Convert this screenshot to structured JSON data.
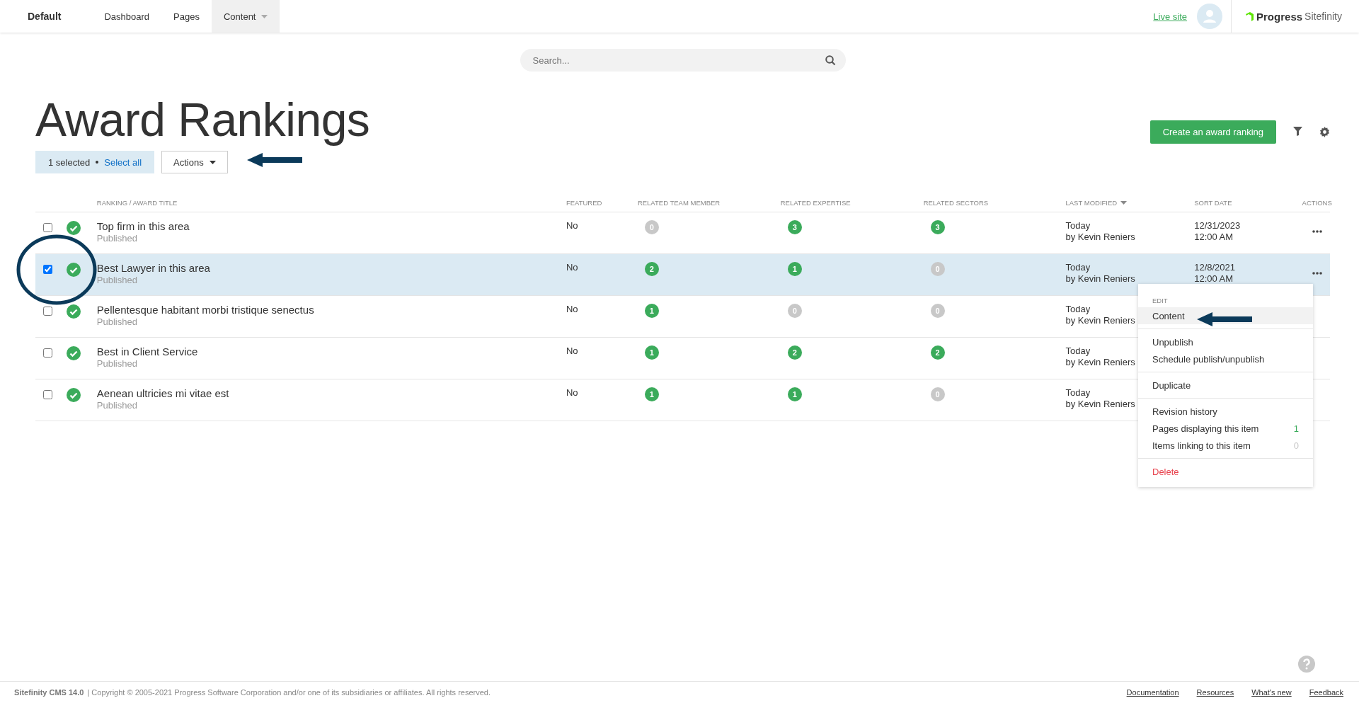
{
  "topbar": {
    "site": "Default",
    "nav": [
      {
        "label": "Dashboard",
        "selected": false,
        "dropdown": false
      },
      {
        "label": "Pages",
        "selected": false,
        "dropdown": false
      },
      {
        "label": "Content",
        "selected": true,
        "dropdown": true
      }
    ],
    "live_site": "Live site",
    "brand": "Progress",
    "brand_product": "Sitefinity"
  },
  "search": {
    "placeholder": "Search..."
  },
  "title": "Award Rankings",
  "selection": {
    "count": "1 selected",
    "select_all": "Select all"
  },
  "actions_button": "Actions",
  "create_button": "Create an award ranking",
  "table": {
    "columns": [
      {
        "label": "RANKING / AWARD TITLE",
        "sorted": false
      },
      {
        "label": "FEATURED",
        "sorted": false
      },
      {
        "label": "RELATED TEAM MEMBER",
        "sorted": false
      },
      {
        "label": "RELATED EXPERTISE",
        "sorted": false
      },
      {
        "label": "RELATED SECTORS",
        "sorted": false
      },
      {
        "label": "LAST MODIFIED",
        "sorted": true
      },
      {
        "label": "SORT DATE",
        "sorted": false
      },
      {
        "label": "ACTIONS",
        "sorted": false
      }
    ],
    "rows": [
      {
        "selected": false,
        "checked": false,
        "kind": "published",
        "title": "Top firm in this area",
        "state": "Published",
        "featured": "No",
        "team": {
          "value": "0",
          "color": "#c8c8c8"
        },
        "expertise": {
          "value": "3",
          "color": "#3bab5b"
        },
        "sectors": {
          "value": "3",
          "color": "#3bab5b"
        },
        "modified": "Today",
        "modified_by": "by Kevin Reniers",
        "sort_date": "12/31/2023",
        "sort_time": "12:00 AM",
        "actions": true
      },
      {
        "selected": true,
        "checked": true,
        "kind": "published",
        "title": "Best Lawyer in this area",
        "state": "Published",
        "featured": "No",
        "team": {
          "value": "2",
          "color": "#3bab5b"
        },
        "expertise": {
          "value": "1",
          "color": "#3bab5b"
        },
        "sectors": {
          "value": "0",
          "color": "#c8c8c8"
        },
        "modified": "Today",
        "modified_by": "by Kevin Reniers",
        "sort_date": "12/8/2021",
        "sort_time": "12:00 AM",
        "actions": true
      },
      {
        "selected": false,
        "checked": false,
        "kind": "published",
        "title": "Pellentesque habitant morbi tristique senectus",
        "state": "Published",
        "featured": "No",
        "team": {
          "value": "1",
          "color": "#3bab5b"
        },
        "expertise": {
          "value": "0",
          "color": "#c8c8c8"
        },
        "sectors": {
          "value": "0",
          "color": "#c8c8c8"
        },
        "modified": "Today",
        "modified_by": "by Kevin Reniers",
        "actions": false
      },
      {
        "selected": false,
        "checked": false,
        "kind": "published",
        "title": "Best in Client Service",
        "state": "Published",
        "featured": "No",
        "team": {
          "value": "1",
          "color": "#3bab5b"
        },
        "expertise": {
          "value": "2",
          "color": "#3bab5b"
        },
        "sectors": {
          "value": "2",
          "color": "#3bab5b"
        },
        "modified": "Today",
        "modified_by": "by Kevin Reniers",
        "actions": false
      },
      {
        "selected": false,
        "checked": false,
        "kind": "published",
        "title": "Aenean ultricies mi vitae est",
        "state": "Published",
        "featured": "No",
        "team": {
          "value": "1",
          "color": "#3bab5b"
        },
        "expertise": {
          "value": "1",
          "color": "#3bab5b"
        },
        "sectors": {
          "value": "0",
          "color": "#c8c8c8"
        },
        "modified": "Today",
        "modified_by": "by Kevin Reniers",
        "actions": false
      }
    ]
  },
  "menu": {
    "sections": [
      {
        "heading": "EDIT",
        "items": [
          {
            "label": "Content",
            "kind": "normal",
            "selected": true
          }
        ]
      },
      {
        "items": [
          {
            "label": "Unpublish",
            "kind": "normal",
            "selected": false
          },
          {
            "label": "Schedule publish/unpublish",
            "kind": "normal",
            "selected": false
          }
        ]
      },
      {
        "items": [
          {
            "label": "Duplicate",
            "kind": "normal",
            "selected": false
          }
        ]
      },
      {
        "items": [
          {
            "label": "Revision history",
            "kind": "normal",
            "selected": false
          },
          {
            "label": "Pages displaying this item",
            "kind": "normal",
            "selected": false,
            "count": "1",
            "color": "#3bab5b"
          },
          {
            "label": "Items linking to this item",
            "kind": "normal",
            "selected": false,
            "count": "0",
            "color": "#c8c8c8"
          }
        ]
      },
      {
        "items": [
          {
            "label": "Delete",
            "kind": "danger",
            "selected": false
          }
        ]
      }
    ]
  },
  "footer": {
    "product": "Sitefinity CMS 14.0",
    "copyright": "| Copyright © 2005-2021 Progress Software Corporation and/or one of its subsidiaries or affiliates. All rights reserved.",
    "links": [
      "Documentation",
      "Resources",
      "What's new",
      "Feedback"
    ]
  }
}
